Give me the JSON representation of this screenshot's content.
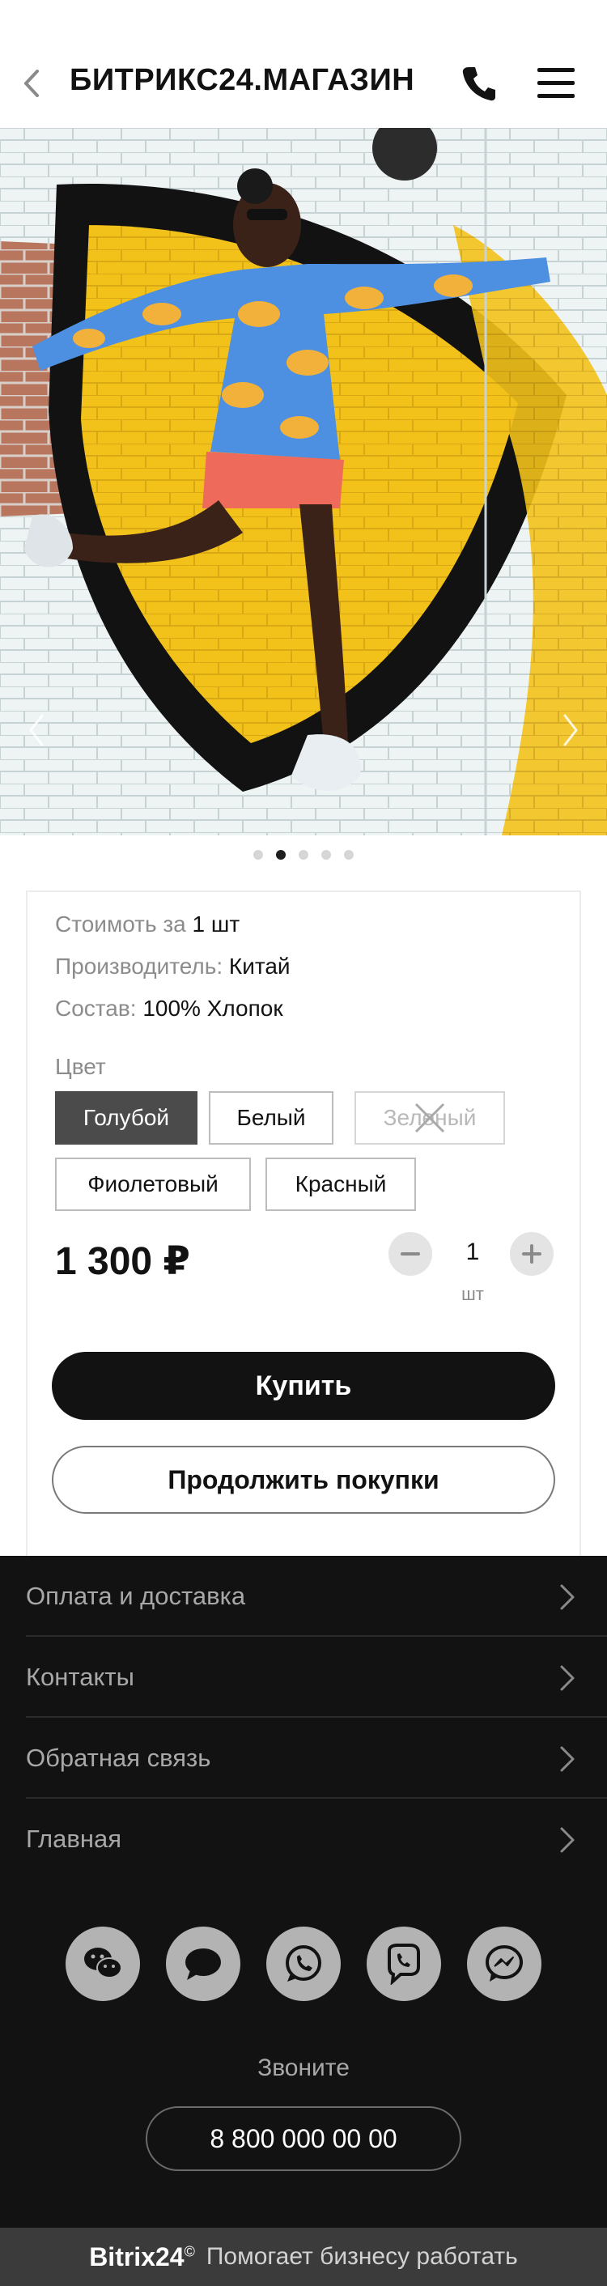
{
  "header": {
    "brand": "БИТРИКС24.МАГАЗИН",
    "back_icon": "chevron-left-icon",
    "phone_icon": "phone-icon",
    "menu_icon": "hamburger-menu-icon"
  },
  "gallery": {
    "image_description_icon": "product-photo",
    "total_slides": 5,
    "active_slide": 2
  },
  "product": {
    "properties": [
      {
        "label": "Стоимоть за",
        "value": "1 шт"
      },
      {
        "label": "Производитель:",
        "value": "Китай"
      },
      {
        "label": "Состав:",
        "value": "100% Хлопок"
      }
    ],
    "color_label": "Цвет",
    "colors": [
      {
        "label": "Голубой",
        "state": "selected"
      },
      {
        "label": "Белый",
        "state": "available"
      },
      {
        "label": "Зеленый",
        "state": "unavailable"
      },
      {
        "label": "Фиолетовый",
        "state": "available"
      },
      {
        "label": "Красный",
        "state": "available"
      }
    ],
    "price": "1 300 ₽",
    "quantity": "1",
    "unit": "шт",
    "buy_label": "Купить",
    "continue_label": "Продолжить покупки"
  },
  "footer": {
    "nav": [
      {
        "label": "Оплата и доставка"
      },
      {
        "label": "Контакты"
      },
      {
        "label": "Обратная связь"
      },
      {
        "label": "Главная"
      }
    ],
    "socials": [
      "wechat-icon",
      "chat-bubble-icon",
      "whatsapp-icon",
      "viber-icon",
      "messenger-icon"
    ],
    "call_label": "Звоните",
    "phone": "8 800 000 00 00",
    "powered_brand": "Bitrix24",
    "powered_mark": "©",
    "powered_text": "Помогает бизнесу работать"
  },
  "colors": {
    "primary": "#121212",
    "footer_bg": "#121212",
    "bottom_bar": "#3b3b3b",
    "selected_option": "#4b4b4b"
  }
}
